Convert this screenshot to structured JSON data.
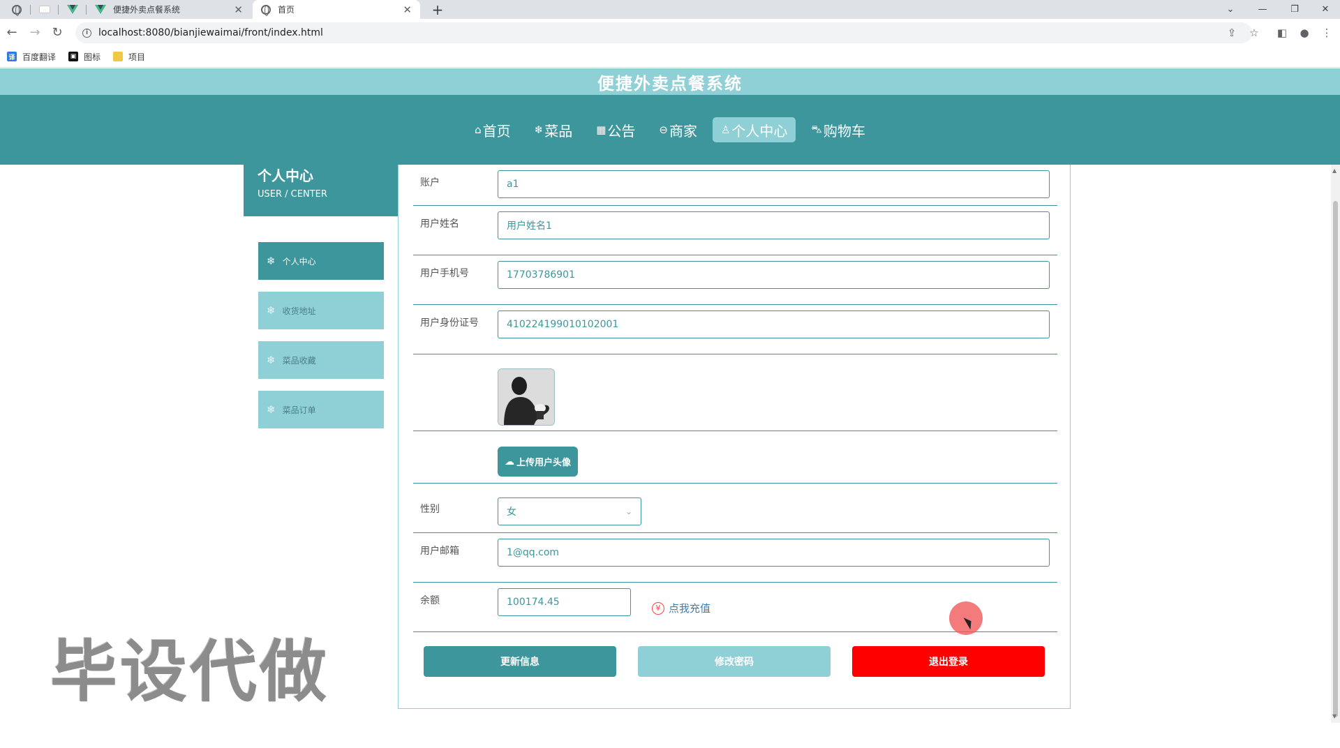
{
  "browser": {
    "tabs": [
      {
        "title": "便捷外卖点餐系统",
        "active": false
      },
      {
        "title": "首页",
        "active": true
      }
    ],
    "url": "localhost:8080/bianjiewaimai/front/index.html",
    "bookmarks": [
      "百度翻译",
      "图标",
      "项目"
    ]
  },
  "site": {
    "title": "便捷外卖点餐系统",
    "nav": [
      {
        "label": "首页",
        "icon": "home-icon",
        "active": false
      },
      {
        "label": "菜品",
        "icon": "snowflake-icon",
        "active": false
      },
      {
        "label": "公告",
        "icon": "notice-icon",
        "active": false
      },
      {
        "label": "商家",
        "icon": "store-icon",
        "active": false
      },
      {
        "label": "个人中心",
        "icon": "user-icon",
        "active": true
      },
      {
        "label": "购物车",
        "icon": "cart-icon",
        "active": false
      }
    ]
  },
  "sidebar": {
    "title": "个人中心",
    "subtitle": "USER / CENTER",
    "items": [
      {
        "label": "个人中心",
        "active": true
      },
      {
        "label": "收货地址",
        "active": false
      },
      {
        "label": "菜品收藏",
        "active": false
      },
      {
        "label": "菜品订单",
        "active": false
      }
    ]
  },
  "form": {
    "account": {
      "label": "账户",
      "value": "a1"
    },
    "name": {
      "label": "用户姓名",
      "value": "用户姓名1"
    },
    "phone": {
      "label": "用户手机号",
      "value": "17703786901"
    },
    "idcard": {
      "label": "用户身份证号",
      "value": "410224199010102001"
    },
    "upload_label": "上传用户头像",
    "gender": {
      "label": "性别",
      "value": "女"
    },
    "email": {
      "label": "用户邮箱",
      "value": "1@qq.com"
    },
    "balance": {
      "label": "余额",
      "value": "100174.45"
    },
    "recharge_label": "点我充值",
    "recharge_symbol": "¥",
    "buttons": {
      "update": "更新信息",
      "change_password": "修改密码",
      "logout": "退出登录"
    }
  },
  "watermark": "毕设代做",
  "colors": {
    "primary": "#3c969c",
    "light": "#8fcfd6",
    "danger": "#ff0000"
  }
}
